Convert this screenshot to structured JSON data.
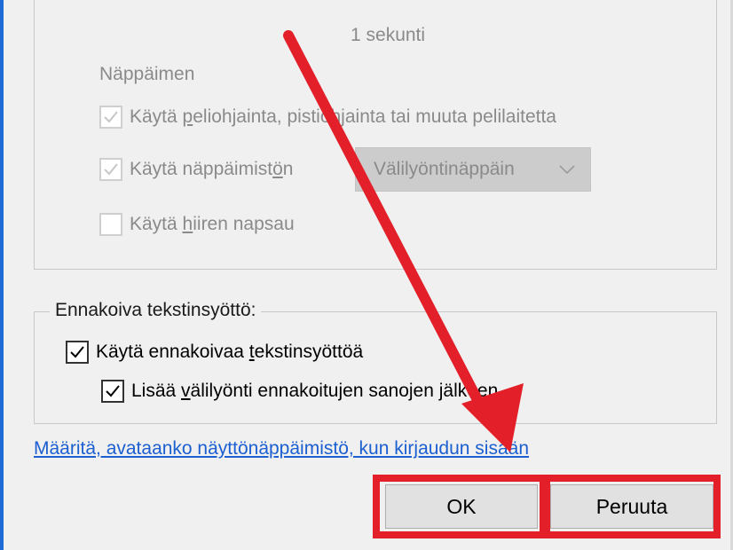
{
  "upper_group": {
    "seconds_text": "1 sekunti",
    "section_label": "Näppäimen",
    "gamepad": {
      "prefix": "Käytä ",
      "underlined": "p",
      "rest": "eliohjainta, pistiohjainta tai muuta pelilaitetta",
      "checked": true
    },
    "keyboard": {
      "prefix": "Käytä näppäimist",
      "underlined": "ö",
      "rest": "n",
      "checked": true
    },
    "keyboard_select": {
      "selected": "Välilyöntinäppäin"
    },
    "mouse": {
      "prefix": "Käytä ",
      "underlined": "h",
      "rest": "iiren napsau",
      "checked": false
    }
  },
  "predictive": {
    "legend": "Ennakoiva tekstinsyöttö:",
    "use_predictive": {
      "prefix": "Käytä ennakoivaa ",
      "underlined": "t",
      "rest": "ekstinsyöttöä",
      "checked": true
    },
    "add_space": {
      "prefix": "Lisää ",
      "underlined": "v",
      "rest": "älilyönti ennakoitujen sanojen jälkeen",
      "checked": true
    }
  },
  "link_text": "Määritä, avataanko näyttönäppäimistö, kun kirjaudun sisään",
  "buttons": {
    "ok": "OK",
    "cancel": "Peruuta"
  },
  "colors": {
    "highlight": "#e3202a",
    "link": "#1b5fd1",
    "accent_edge": "#1e6bd6"
  },
  "icons": {
    "checkbox_check": "check-icon",
    "dropdown": "chevron-down-icon",
    "annotation": "red-arrow"
  }
}
